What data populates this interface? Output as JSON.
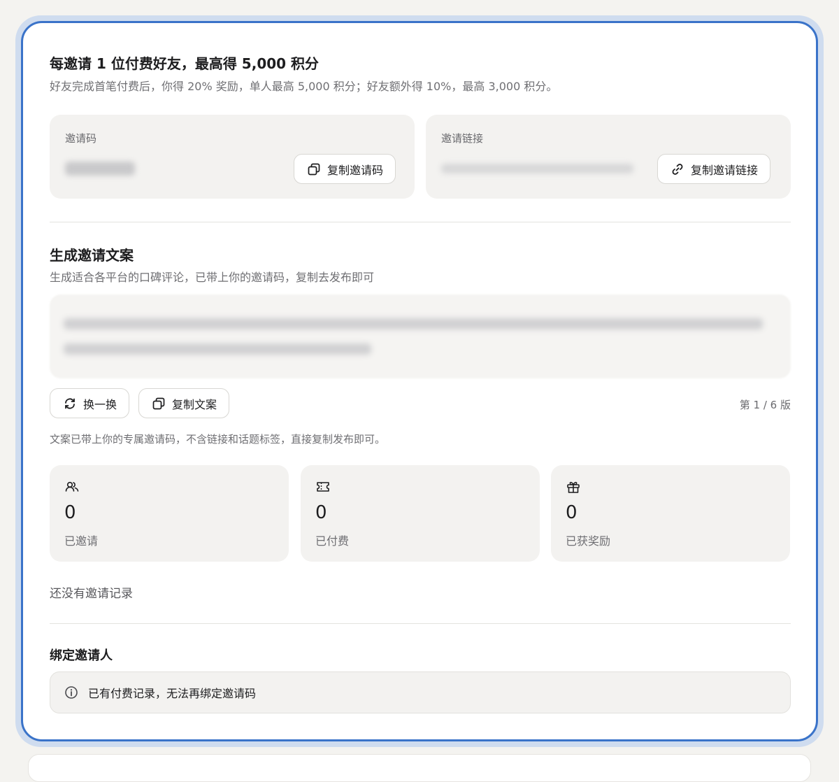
{
  "header": {
    "title": "每邀请 1 位付费好友，最高得 5,000 积分",
    "subtitle": "好友完成首笔付费后，你得 20% 奖励，单人最高 5,000 积分；好友额外得 10%，最高 3,000 积分。"
  },
  "invite_code": {
    "label": "邀请码",
    "copy_label": "复制邀请码"
  },
  "invite_link": {
    "label": "邀请链接",
    "copy_label": "复制邀请链接"
  },
  "copywriting": {
    "title": "生成邀请文案",
    "description": "生成适合各平台的口碑评论，已带上你的邀请码，复制去发布即可",
    "shuffle_label": "换一换",
    "copy_label": "复制文案",
    "version": "第 1 / 6 版",
    "note": "文案已带上你的专属邀请码，不含链接和话题标签，直接复制发布即可。"
  },
  "stats": [
    {
      "icon": "users-icon",
      "value": "0",
      "label": "已邀请"
    },
    {
      "icon": "ticket-icon",
      "value": "0",
      "label": "已付费"
    },
    {
      "icon": "gift-icon",
      "value": "0",
      "label": "已获奖励"
    }
  ],
  "records": {
    "empty_text": "还没有邀请记录"
  },
  "bind": {
    "title": "绑定邀请人",
    "notice": "已有付费记录，无法再绑定邀请码"
  }
}
